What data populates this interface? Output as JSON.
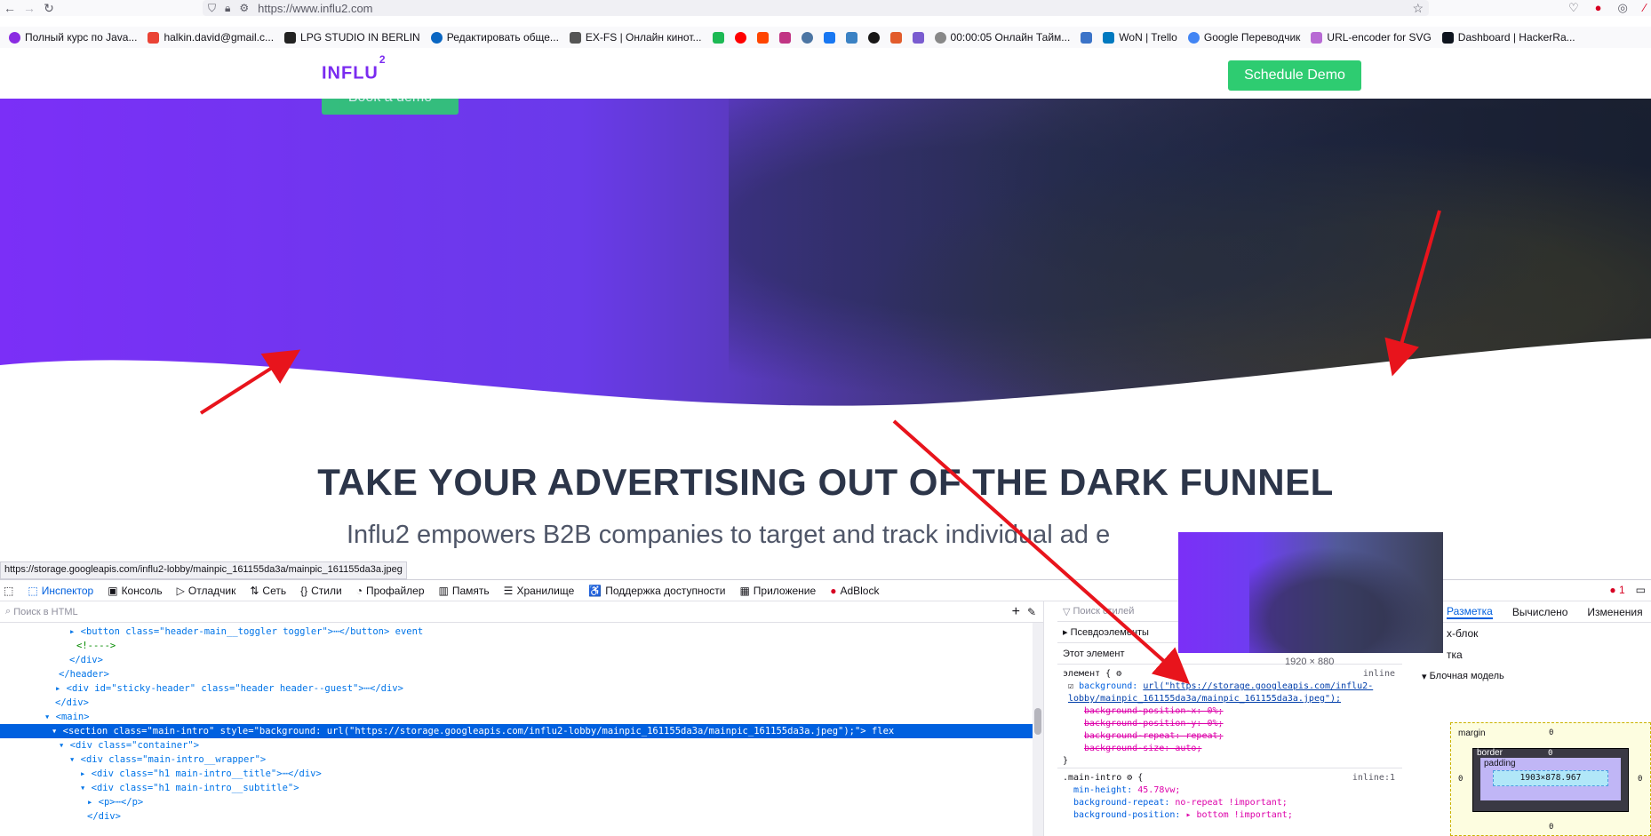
{
  "browser": {
    "url": "https://www.influ2.com",
    "bookmarks": [
      {
        "label": "Полный курс по Java...",
        "color": "#8a2be2"
      },
      {
        "label": "halkin.david@gmail.c...",
        "color": "#ea4335"
      },
      {
        "label": "LPG STUDIO IN BERLIN",
        "color": "#222222"
      },
      {
        "label": "Редактировать обще...",
        "color": "#0a66c2"
      },
      {
        "label": "EX-FS | Онлайн кинот...",
        "color": "#555555"
      },
      {
        "label": "",
        "color": "#1db954"
      },
      {
        "label": "",
        "color": "#ff0000"
      },
      {
        "label": "",
        "color": "#ff4500"
      },
      {
        "label": "",
        "color": "#c13584"
      },
      {
        "label": "",
        "color": "#4c75a3"
      },
      {
        "label": "",
        "color": "#1877f2"
      },
      {
        "label": "",
        "color": "#3b82c4"
      },
      {
        "label": "",
        "color": "#181717"
      },
      {
        "label": "",
        "color": "#e25c2c"
      },
      {
        "label": "",
        "color": "#7a5cd0"
      },
      {
        "label": "00:00:05 Онлайн Тайм...",
        "color": "#888888"
      },
      {
        "label": "",
        "color": "#3b73c8"
      },
      {
        "label": "WoN | Trello",
        "color": "#0079bf"
      },
      {
        "label": "Google Переводчик",
        "color": "#4285f4"
      },
      {
        "label": "URL-encoder for SVG",
        "color": "#b86ad4"
      },
      {
        "label": "Dashboard | HackerRa...",
        "color": "#0e141e"
      }
    ]
  },
  "site": {
    "logo": "INFLU",
    "logo_sup": "2",
    "schedule_demo": "Schedule Demo",
    "book_demo": "Book a demo",
    "headline": "TAKE YOUR ADVERTISING OUT OF THE DARK FUNNEL",
    "subline": "Influ2 empowers B2B companies to target and track individual ad e"
  },
  "status_url": "https://storage.googleapis.com/influ2-lobby/mainpic_161155da3a/mainpic_161155da3a.jpeg",
  "devtools": {
    "tabs": [
      "Инспектор",
      "Консоль",
      "Отладчик",
      "Сеть",
      "Стили",
      "Профайлер",
      "Память",
      "Хранилище",
      "Поддержка доступности",
      "Приложение",
      "AdBlock"
    ],
    "error_count": "1",
    "html_search_placeholder": "Поиск в HTML",
    "tree_lines": [
      "▸ <button class=\"header-main__toggler toggler\">⋯</button> event",
      "<!---->",
      "</div>",
      "</header>",
      "▸ <div id=\"sticky-header\" class=\"header header--guest\">⋯</div>",
      "</div>",
      "▾ <main>",
      "▾ <section class=\"main-intro\" style=\"background: url(\"https://storage.googleapis.com/influ2-lobby/mainpic_161155da3a/mainpic_161155da3a.jpeg\");\"> flex",
      "▾ <div class=\"container\">",
      "▾ <div class=\"main-intro__wrapper\">",
      "▸ <div class=\"h1 main-intro__title\">⋯</div>",
      "▾ <div class=\"h1 main-intro__subtitle\">",
      "▸ <p>⋯</p>",
      "</div>"
    ],
    "styles_search": "Поиск стилей",
    "pseudo": "Псевдоэлементы",
    "this_element": "Этот элемент",
    "element_rule": {
      "selector": "элемент {",
      "source": "inline",
      "bg_prop": "background:",
      "bg_value": "url(\"https://storage.googleapis.com/influ2-lobby/mainpic_161155da3a/mainpic_161155da3a.jpeg\");",
      "sub": [
        "background-position-x: 0%;",
        "background-position-y: 0%;",
        "background-repeat: repeat;",
        "background-size: auto;"
      ]
    },
    "main_intro_rule": {
      "selector": ".main-intro",
      "source": "inline:1",
      "props": [
        "min-height: 45.78vw;",
        "background-repeat: no-repeat !important;",
        "background-position: ▸ bottom !important;"
      ]
    },
    "preview_size": "1920 × 880",
    "layout_tabs": [
      "Разметка",
      "Вычислено",
      "Изменения"
    ],
    "flex_label": "x-блок",
    "grid_label": "тка",
    "box_model_title": "Блочная модель",
    "box": {
      "margin": "margin",
      "border": "border",
      "padding": "padding",
      "content": "1903×878.967",
      "zero": "0"
    }
  }
}
